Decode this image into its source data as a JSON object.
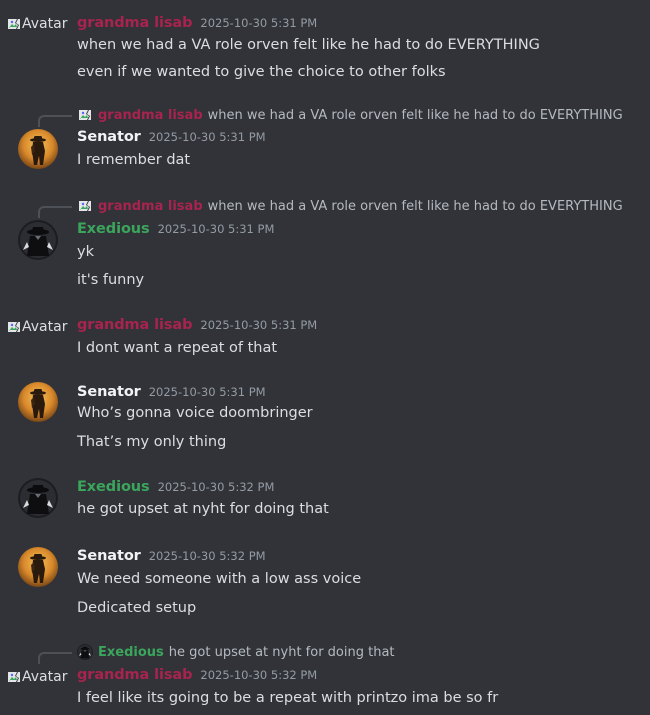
{
  "colors": {
    "background": "#313338",
    "grandma": "#a8234d",
    "senator": "#f2f3f5",
    "exedious": "#3ba55c",
    "text": "#dbdee1",
    "muted": "#949ba4"
  },
  "messages": [
    {
      "avatar_alt": "Avatar",
      "username": "grandma lisab",
      "timestamp": "2025-10-30 5:31 PM",
      "lines": [
        "when we had a VA role orven felt like he had to do EVERYTHING",
        "even if we wanted to give the choice to other folks"
      ]
    },
    {
      "reply": {
        "username": "grandma lisab",
        "text": "when we had a VA role orven felt like he had to do EVERYTHING"
      },
      "username": "Senator",
      "timestamp": "2025-10-30 5:31 PM",
      "lines": [
        "I remember dat"
      ]
    },
    {
      "reply": {
        "username": "grandma lisab",
        "text": "when we had a VA role orven felt like he had to do EVERYTHING"
      },
      "username": "Exedious",
      "timestamp": "2025-10-30 5:31 PM",
      "lines": [
        "yk",
        "it's funny"
      ]
    },
    {
      "avatar_alt": "Avatar",
      "username": "grandma lisab",
      "timestamp": "2025-10-30 5:31 PM",
      "lines": [
        "I dont want a repeat of that"
      ]
    },
    {
      "username": "Senator",
      "timestamp": "2025-10-30 5:31 PM",
      "lines": [
        "Who’s gonna voice doombringer",
        "That’s my only thing"
      ]
    },
    {
      "username": "Exedious",
      "timestamp": "2025-10-30 5:32 PM",
      "lines": [
        "he got upset at nyht for doing that"
      ]
    },
    {
      "username": "Senator",
      "timestamp": "2025-10-30 5:32 PM",
      "lines": [
        "We need someone with a low ass voice",
        "Dedicated setup"
      ]
    },
    {
      "reply": {
        "username": "Exedious",
        "text": "he got upset at nyht for doing that"
      },
      "avatar_alt": "Avatar",
      "username": "grandma lisab",
      "timestamp": "2025-10-30 5:32 PM",
      "lines": [
        "I feel like its going to be a repeat with printzo ima be so fr"
      ]
    }
  ]
}
